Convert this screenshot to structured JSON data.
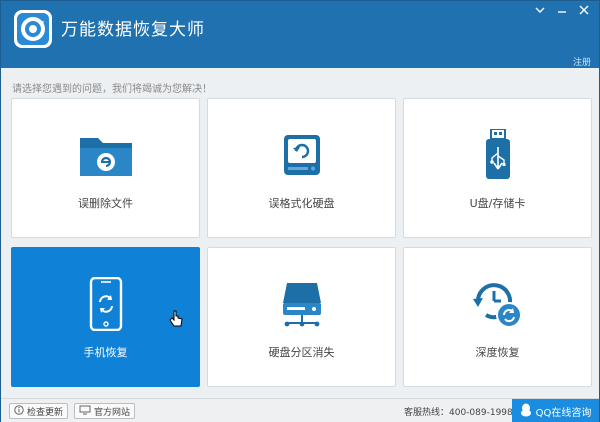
{
  "app": {
    "title": "万能数据恢复大师",
    "register": "注册"
  },
  "hint": "请选择您遇到的问题，我们将竭诚为您解决！",
  "tiles": [
    {
      "label": "误删除文件",
      "icon": "folder-recover-icon"
    },
    {
      "label": "误格式化硬盘",
      "icon": "disk-format-icon"
    },
    {
      "label": "U盘/存储卡",
      "icon": "usb-drive-icon"
    },
    {
      "label": "手机恢复",
      "icon": "phone-recover-icon"
    },
    {
      "label": "硬盘分区消失",
      "icon": "disk-partition-icon"
    },
    {
      "label": "深度恢复",
      "icon": "deep-recover-icon"
    }
  ],
  "status": {
    "check_update": "检查更新",
    "website": "官方网站",
    "hotline": "客服热线：400-089-1998",
    "qq": "QQ在线咨询"
  },
  "colors": {
    "titlebar": "#2071b0",
    "accent": "#0f82d7",
    "icon": "#1d6fa8"
  }
}
